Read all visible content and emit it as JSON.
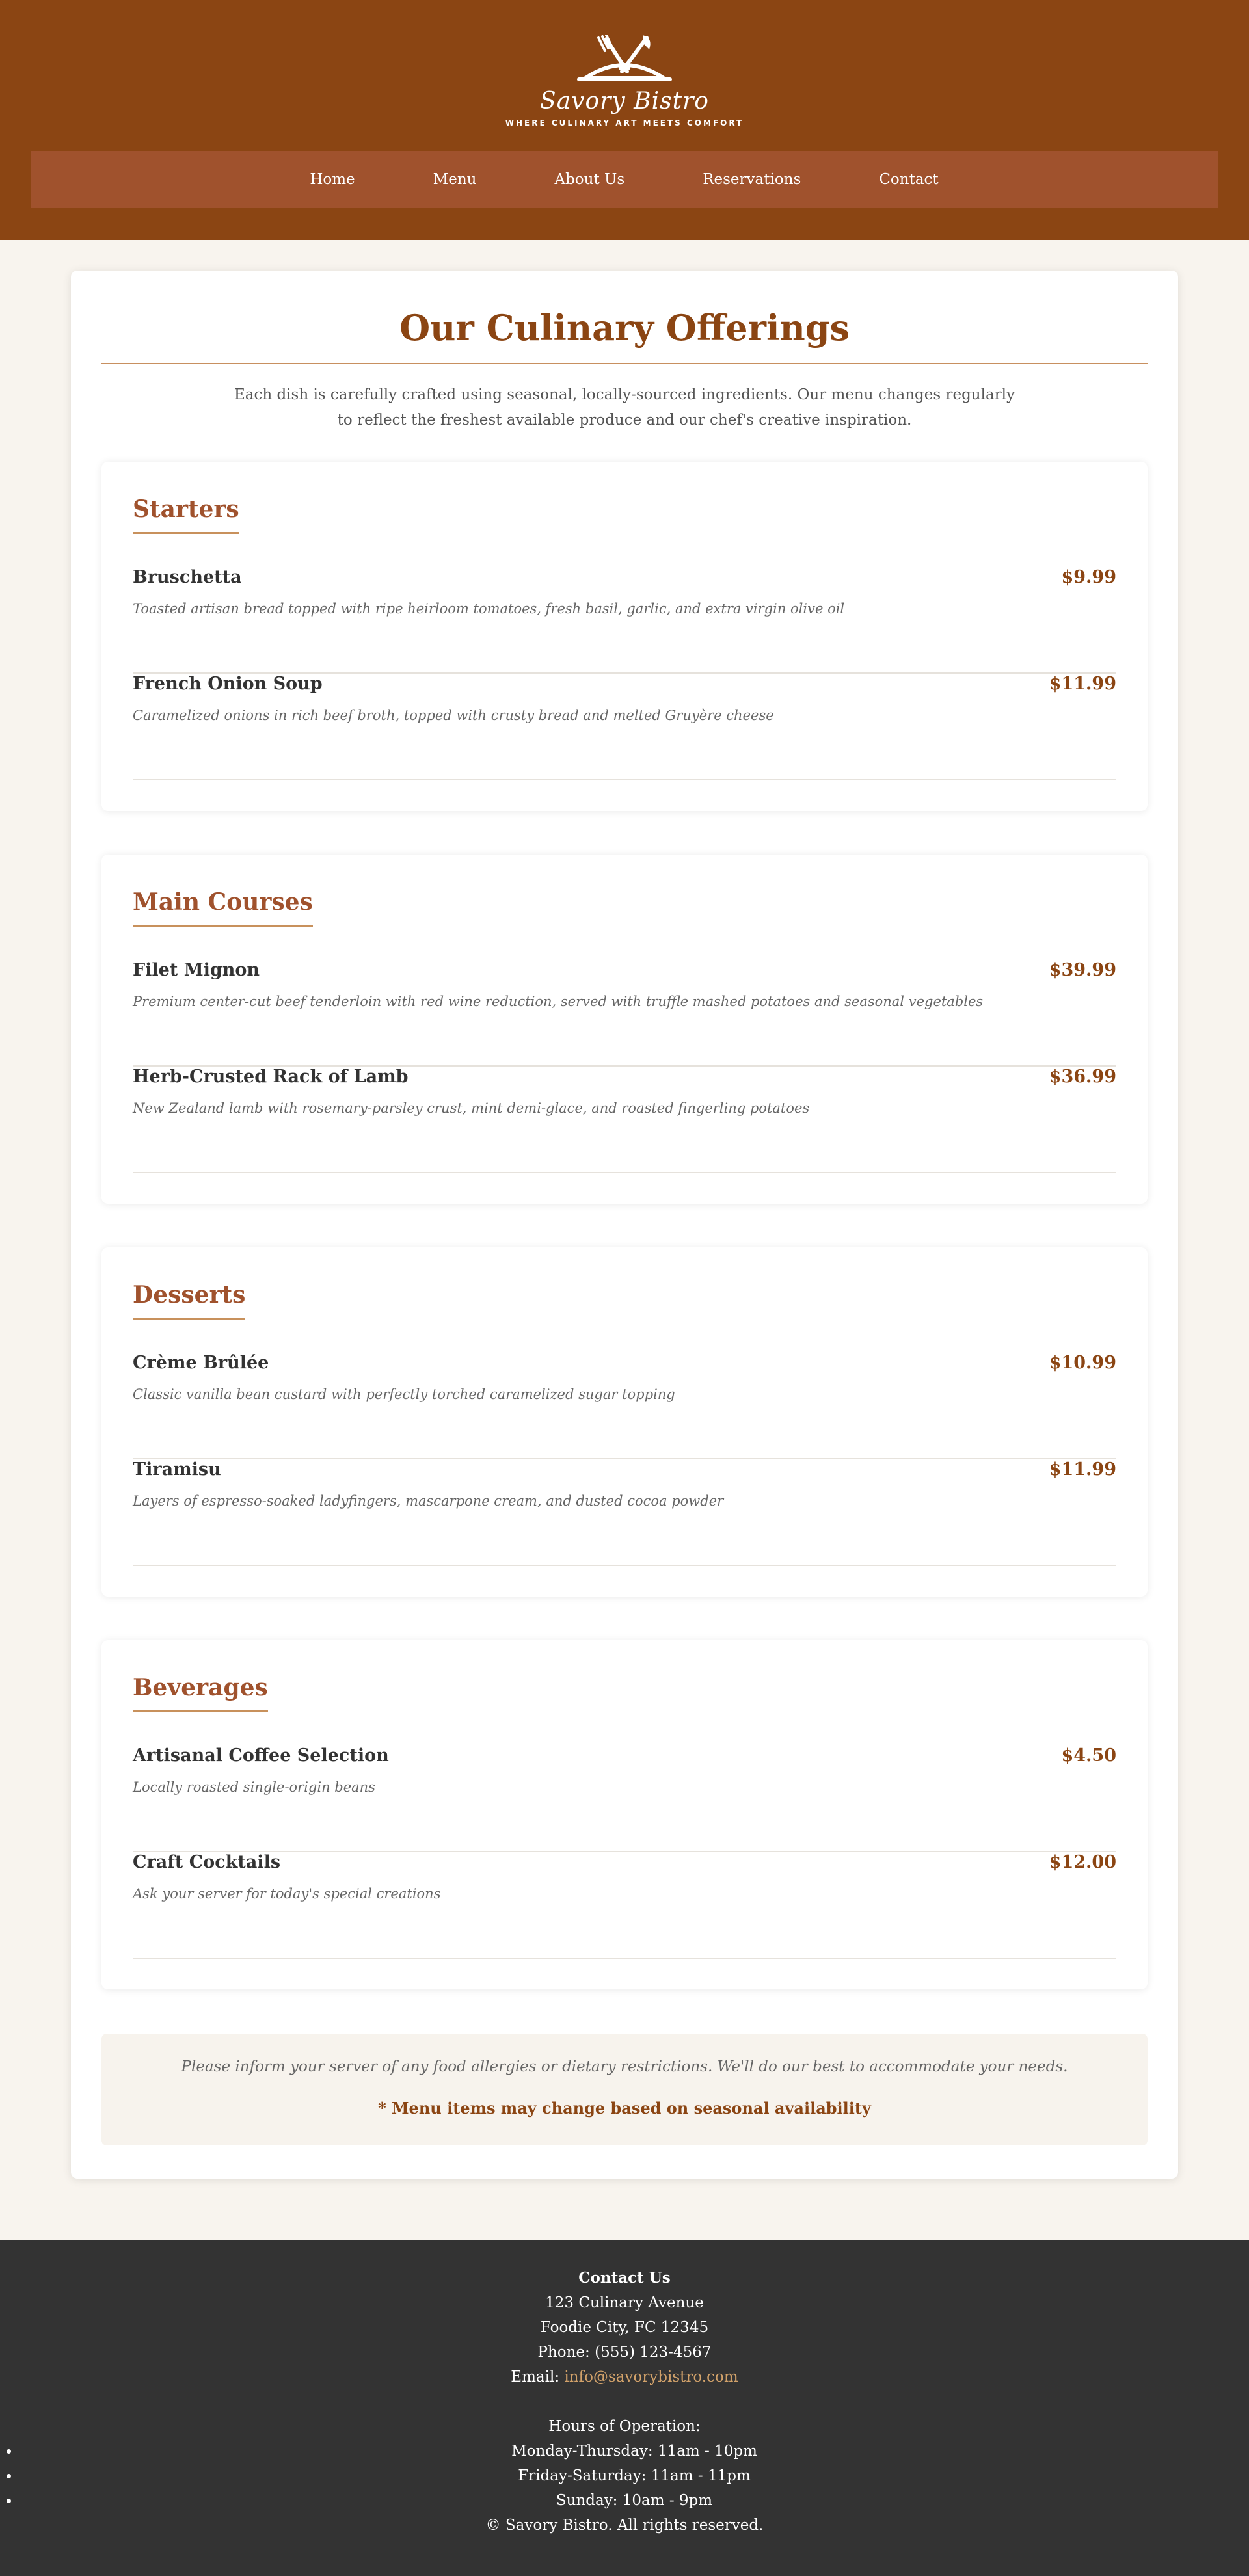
{
  "brand": {
    "name": "Savory Bistro",
    "tagline": "WHERE CULINARY ART MEETS COMFORT",
    "logo_icon": "crossed-fork-knife-cloche-icon"
  },
  "nav": {
    "items": [
      "Home",
      "Menu",
      "About Us",
      "Reservations",
      "Contact"
    ]
  },
  "main": {
    "title": "Our Culinary Offerings",
    "intro": "Each dish is carefully crafted using seasonal, locally-sourced ingredients. Our menu changes regularly to reflect the freshest available produce and our chef's creative inspiration."
  },
  "sections": [
    {
      "title": "Starters",
      "items": [
        {
          "name": "Bruschetta",
          "price": "$9.99",
          "description": "Toasted artisan bread topped with ripe heirloom tomatoes, fresh basil, garlic, and extra virgin olive oil"
        },
        {
          "name": "French Onion Soup",
          "price": "$11.99",
          "description": "Caramelized onions in rich beef broth, topped with crusty bread and melted Gruyère cheese"
        }
      ]
    },
    {
      "title": "Main Courses",
      "items": [
        {
          "name": "Filet Mignon",
          "price": "$39.99",
          "description": "Premium center-cut beef tenderloin with red wine reduction, served with truffle mashed potatoes and seasonal vegetables"
        },
        {
          "name": "Herb-Crusted Rack of Lamb",
          "price": "$36.99",
          "description": "New Zealand lamb with rosemary-parsley crust, mint demi-glace, and roasted fingerling potatoes"
        }
      ]
    },
    {
      "title": "Desserts",
      "items": [
        {
          "name": "Crème Brûlée",
          "price": "$10.99",
          "description": "Classic vanilla bean custard with perfectly torched caramelized sugar topping"
        },
        {
          "name": "Tiramisu",
          "price": "$11.99",
          "description": "Layers of espresso-soaked ladyfingers, mascarpone cream, and dusted cocoa powder"
        }
      ]
    },
    {
      "title": "Beverages",
      "items": [
        {
          "name": "Artisanal Coffee Selection",
          "price": "$4.50",
          "description": "Locally roasted single-origin beans"
        },
        {
          "name": "Craft Cocktails",
          "price": "$12.00",
          "description": "Ask your server for today's special creations"
        }
      ]
    }
  ],
  "notice": {
    "text": "Please inform your server of any food allergies or dietary restrictions. We'll do our best to accommodate your needs.",
    "strong": "* Menu items may change based on seasonal availability"
  },
  "footer": {
    "heading": "Contact Us",
    "address1": "123 Culinary Avenue",
    "address2": "Foodie City, FC 12345",
    "phone": "Phone: (555) 123-4567",
    "email_label": "Email: ",
    "email": "info@savorybistro.com",
    "hours_heading": "Hours of Operation:",
    "hours": [
      "Monday-Thursday: 11am - 10pm",
      "Friday-Saturday: 11am - 11pm",
      "Sunday: 10am - 9pm"
    ],
    "copyright": "© Savory Bistro. All rights reserved."
  },
  "colors": {
    "brand": "#8b4513",
    "nav_bg": "#a0522d",
    "accent": "#c8915c",
    "page_bg": "#f8f4ee",
    "footer_bg": "#333333"
  }
}
